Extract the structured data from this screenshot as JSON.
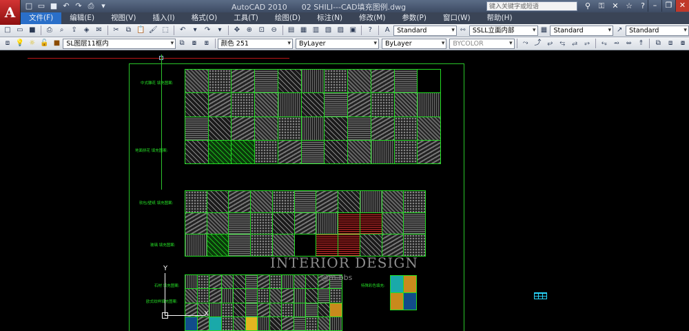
{
  "window": {
    "app_name": "AutoCAD 2010",
    "file_name": "02 SHILI---CAD填充图例.dwg",
    "app_logo": "A"
  },
  "search": {
    "placeholder": "键入关键字或短语"
  },
  "menu": {
    "items": [
      "文件(F)",
      "编辑(E)",
      "视图(V)",
      "插入(I)",
      "格式(O)",
      "工具(T)",
      "绘图(D)",
      "标注(N)",
      "修改(M)",
      "参数(P)",
      "窗口(W)",
      "帮助(H)"
    ],
    "active_index": 0
  },
  "toolbar1": {
    "text_style": "Standard",
    "dim_style": "SSLL立面内部",
    "table_style": "Standard",
    "multileader_style": "Standard"
  },
  "toolbar2": {
    "layer": "SL图层11框内",
    "color": "颜色 251",
    "linetype": "ByLayer",
    "lineweight": "ByLayer",
    "plotstyle": "BYCOLOR"
  },
  "canvas": {
    "labels": {
      "group1": "中式雕花 填充图案:",
      "group2": "地面拼花 填充图案:",
      "group3": "软包/壁纸 填充图案:",
      "group4": "玻璃 填充图案:",
      "group5": "石材 填充图案:",
      "group6": "欧式纹样填充图案:",
      "group7": "特殊彩色填充:"
    },
    "watermark": "INTERIOR DESIGN",
    "watermark_sub": "@m-bbs",
    "ucs_x": "X",
    "ucs_y": "Y"
  },
  "colors": {
    "accent": "#2a6fc9",
    "frame": "#29c829",
    "title_bar": "#3d4b63"
  }
}
